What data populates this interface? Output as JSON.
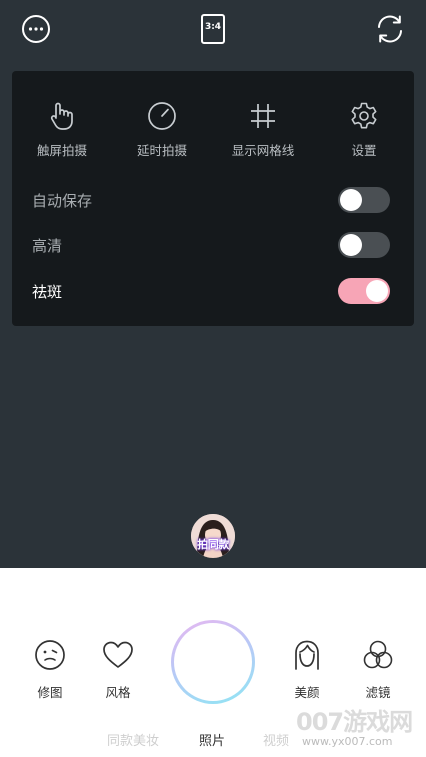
{
  "top_bar": {
    "more_icon": "more-dots-icon",
    "ratio_label": "3:4",
    "switch_icon": "camera-switch-icon"
  },
  "settings_panel": {
    "grid": [
      {
        "label": "触屏拍摄",
        "icon": "touch-shoot-icon"
      },
      {
        "label": "延时拍摄",
        "icon": "timer-icon"
      },
      {
        "label": "显示网格线",
        "icon": "grid-icon"
      },
      {
        "label": "设置",
        "icon": "gear-icon"
      }
    ],
    "toggles": [
      {
        "label": "自动保存",
        "on": false
      },
      {
        "label": "高清",
        "on": false
      },
      {
        "label": "祛斑",
        "on": true
      }
    ]
  },
  "avatar_badge": {
    "label": "拍同款"
  },
  "bottom_bar": {
    "left": [
      {
        "label": "修图",
        "icon": "retouch-face-icon"
      },
      {
        "label": "风格",
        "icon": "heart-icon"
      }
    ],
    "right": [
      {
        "label": "美颜",
        "icon": "beauty-face-icon"
      },
      {
        "label": "滤镜",
        "icon": "filter-circles-icon"
      }
    ],
    "modes": [
      {
        "label": "同款美妆",
        "active": false
      },
      {
        "label": "照片",
        "active": true
      },
      {
        "label": "视频",
        "active": false
      }
    ]
  },
  "watermark": {
    "title": "007游戏网",
    "url": "www.yx007.com"
  },
  "colors": {
    "camera_bg": "#2b3339",
    "panel_bg": "#15191c",
    "toggle_on": "#f7a5b6",
    "toggle_off": "#4a4f53"
  }
}
